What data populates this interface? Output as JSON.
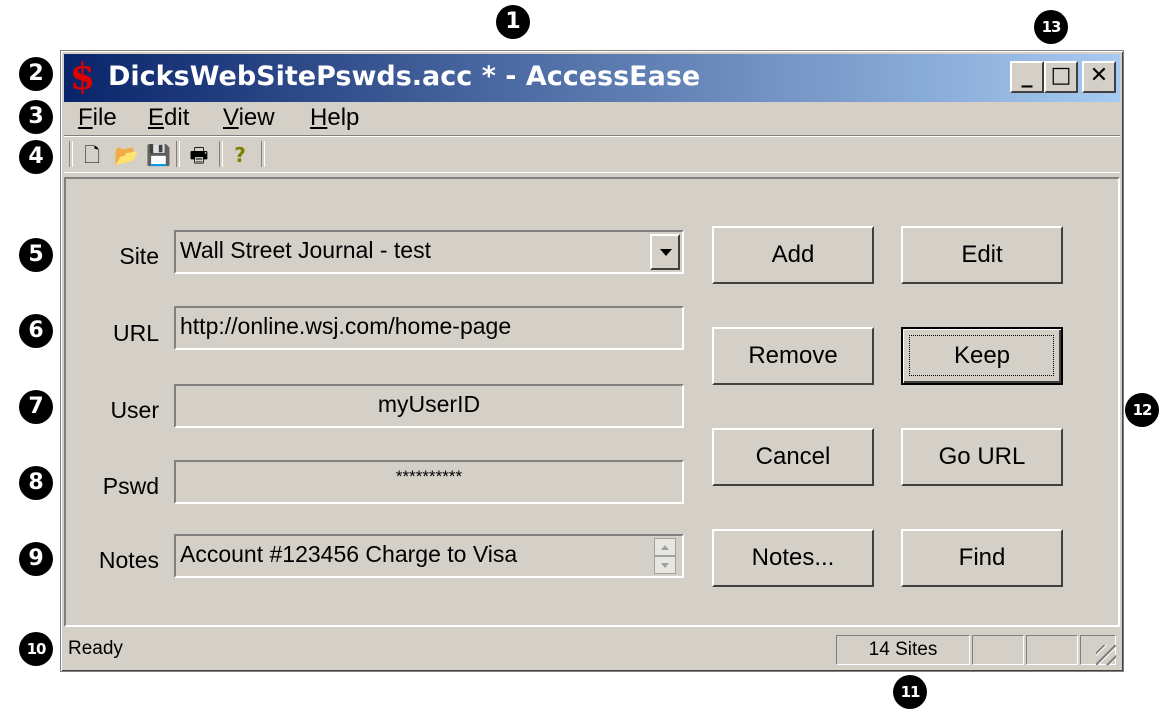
{
  "callouts": [
    "1",
    "2",
    "3",
    "4",
    "5",
    "6",
    "7",
    "8",
    "9",
    "10",
    "11",
    "12",
    "13"
  ],
  "app": {
    "logo": "$",
    "title": "DicksWebSitePswds.acc * - AccessEase",
    "caption_buttons": {
      "minimize": "_",
      "maximize": "□",
      "close": "✕"
    }
  },
  "menu": [
    {
      "mnemonic": "F",
      "rest": "ile"
    },
    {
      "mnemonic": "E",
      "rest": "dit"
    },
    {
      "mnemonic": "V",
      "rest": "iew"
    },
    {
      "mnemonic": "H",
      "rest": "elp"
    }
  ],
  "toolbar": {
    "icons": {
      "new": "🗋",
      "open": "📂",
      "save": "💾",
      "print": "🖶",
      "help": "?"
    }
  },
  "form": {
    "site_label": "Site",
    "site_value": "Wall Street Journal - test",
    "url_label": "URL",
    "url_value": "http://online.wsj.com/home-page",
    "user_label": "User",
    "user_value": "myUserID",
    "pswd_label": "Pswd",
    "pswd_value": "**********",
    "notes_label": "Notes",
    "notes_value": "Account #123456 Charge to Visa"
  },
  "buttons": {
    "add": "Add",
    "edit": "Edit",
    "remove": "Remove",
    "keep": "Keep",
    "cancel": "Cancel",
    "go_url": "Go URL",
    "notes": "Notes...",
    "find": "Find"
  },
  "status": {
    "message": "Ready",
    "site_count": "14 Sites"
  }
}
